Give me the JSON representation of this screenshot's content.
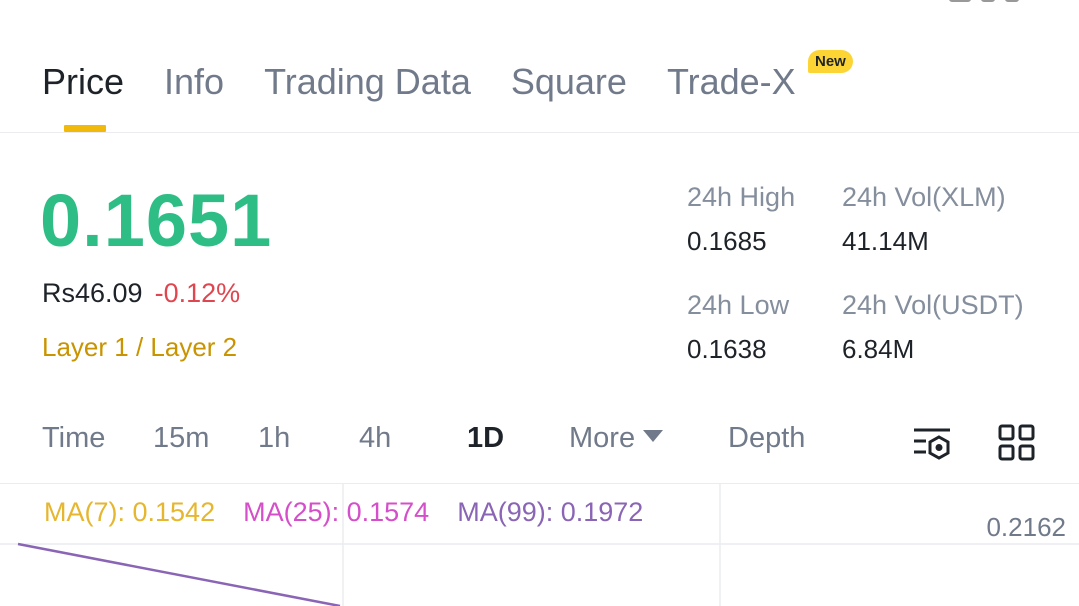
{
  "tabs": [
    {
      "label": "Price",
      "active": true
    },
    {
      "label": "Info",
      "active": false
    },
    {
      "label": "Trading Data",
      "active": false
    },
    {
      "label": "Square",
      "active": false
    },
    {
      "label": "Trade-X",
      "active": false,
      "badge": "New"
    }
  ],
  "price": {
    "last": "0.1651",
    "fiat": "Rs46.09",
    "change": "-0.12%",
    "tags": "Layer 1 / Layer 2"
  },
  "stats": {
    "high_label": "24h High",
    "high_value": "0.1685",
    "vol_base_label": "24h Vol(XLM)",
    "vol_base_value": "41.14M",
    "low_label": "24h Low",
    "low_value": "0.1638",
    "vol_quote_label": "24h Vol(USDT)",
    "vol_quote_value": "6.84M"
  },
  "intervals": [
    {
      "label": "Time",
      "active": false
    },
    {
      "label": "15m",
      "active": false
    },
    {
      "label": "1h",
      "active": false
    },
    {
      "label": "4h",
      "active": false
    },
    {
      "label": "1D",
      "active": true
    },
    {
      "label": "More",
      "active": false,
      "dropdown": true
    },
    {
      "label": "Depth",
      "active": false
    }
  ],
  "toolbar_icons": [
    "indicator-settings-icon",
    "grid-layout-icon"
  ],
  "chart": {
    "ma7": "MA(7): 0.1542",
    "ma25": "MA(25): 0.1574",
    "ma99": "MA(99): 0.1972",
    "y_top_label": "0.2162"
  },
  "colors": {
    "up": "#2ebd85",
    "down": "#e0464f",
    "accent": "#f0b90b",
    "ma7": "#e6b62e",
    "ma25": "#d44fc9",
    "ma99": "#8a65b5"
  }
}
